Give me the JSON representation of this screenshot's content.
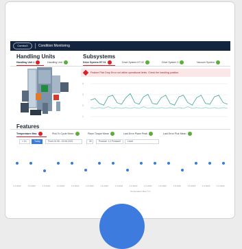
{
  "app": {
    "logo_text": "ComboX",
    "title": "Condition Monitoring"
  },
  "handling": {
    "title": "Handling Units",
    "tabs": [
      {
        "label": "Handling Unit 1",
        "status": "warn"
      },
      {
        "label": "Handling Unit",
        "status": "ok"
      }
    ]
  },
  "subsystems": {
    "title": "Subsystems",
    "tabs": [
      {
        "label": "Drive System HT 01",
        "status": "warn"
      },
      {
        "label": "Drive System HT 02",
        "status": "ok"
      },
      {
        "label": "Drive System 3",
        "status": "ok"
      },
      {
        "label": "Vacuum System",
        "status": "ok"
      }
    ]
  },
  "alert": {
    "message": "Feature Pick Drop Error not within operational limits. Check the handling position."
  },
  "chart_data": {
    "type": "line",
    "ylim": [
      0,
      4
    ],
    "ticks_y": [
      "4",
      "3",
      "2",
      "1"
    ],
    "series": [
      {
        "values": [
          2.0,
          2.2,
          1.6,
          1.4,
          2.4,
          2.6,
          1.7,
          1.5,
          2.3,
          2.8,
          1.7,
          1.5,
          2.4,
          2.7,
          1.6,
          1.5,
          2.3,
          2.6,
          1.6,
          1.4,
          2.4,
          2.6,
          1.7,
          1.4,
          2.3,
          2.6,
          1.6,
          1.5,
          2.4,
          2.6,
          1.7,
          1.5
        ]
      },
      {
        "values": [
          1.1,
          1.0,
          1.1,
          1.0,
          1.2,
          1.0,
          1.1,
          1.0,
          1.1,
          1.0,
          1.1,
          1.0,
          1.2,
          1.0,
          1.1,
          1.0,
          1.1,
          1.0,
          1.1,
          1.0,
          1.1,
          1.0,
          1.2,
          1.0,
          1.1,
          1.0,
          1.1,
          1.0,
          1.1,
          1.0,
          1.1,
          1.0
        ]
      }
    ],
    "colors": [
      "#3aa39a",
      "#8bd0c8"
    ]
  },
  "features": {
    "title": "Features",
    "tabs": [
      {
        "label": "Temperature Max",
        "status": "warn"
      },
      {
        "label": "Pick To Cycle Mean",
        "status": "ok"
      },
      {
        "label": "Place Torque Mean",
        "status": "ok"
      },
      {
        "label": "Last Error Place Peak",
        "status": "ok"
      },
      {
        "label": "Last Error Pick Mean",
        "status": "ok"
      }
    ],
    "controls": {
      "btn_1": "< 1h",
      "btn_2": "Today",
      "range": "From 01.06 - 02.06.2022",
      "count": "30",
      "product": "Product: 1.2 ProductX",
      "unit": "Level"
    },
    "timeline_points": [
      0.98,
      0.98,
      0.6,
      0.96,
      0.96,
      0.62,
      0.96,
      0.96,
      0.62,
      0.96,
      0.96,
      0.96,
      0.62,
      0.96,
      0.96,
      0.98
    ],
    "xticks": [
      "1.6.2022",
      "1.6.2022",
      "1.6.2022",
      "1.6.2022",
      "1.6.2022",
      "1.6.2022",
      "1.6.2022",
      "1.6.2022",
      "1.6.2022",
      "1.6.2022",
      "1.6.2022",
      "1.6.2022",
      "1.6.2022",
      "1.6.2022",
      "1.6.2022"
    ],
    "legend": "Temperature Max (°C)"
  },
  "colors": {
    "nav": "#13243f",
    "accent": "#cc2127",
    "ok": "#5cae3b",
    "warn": "#d6222a",
    "primary": "#3a7bd5"
  }
}
